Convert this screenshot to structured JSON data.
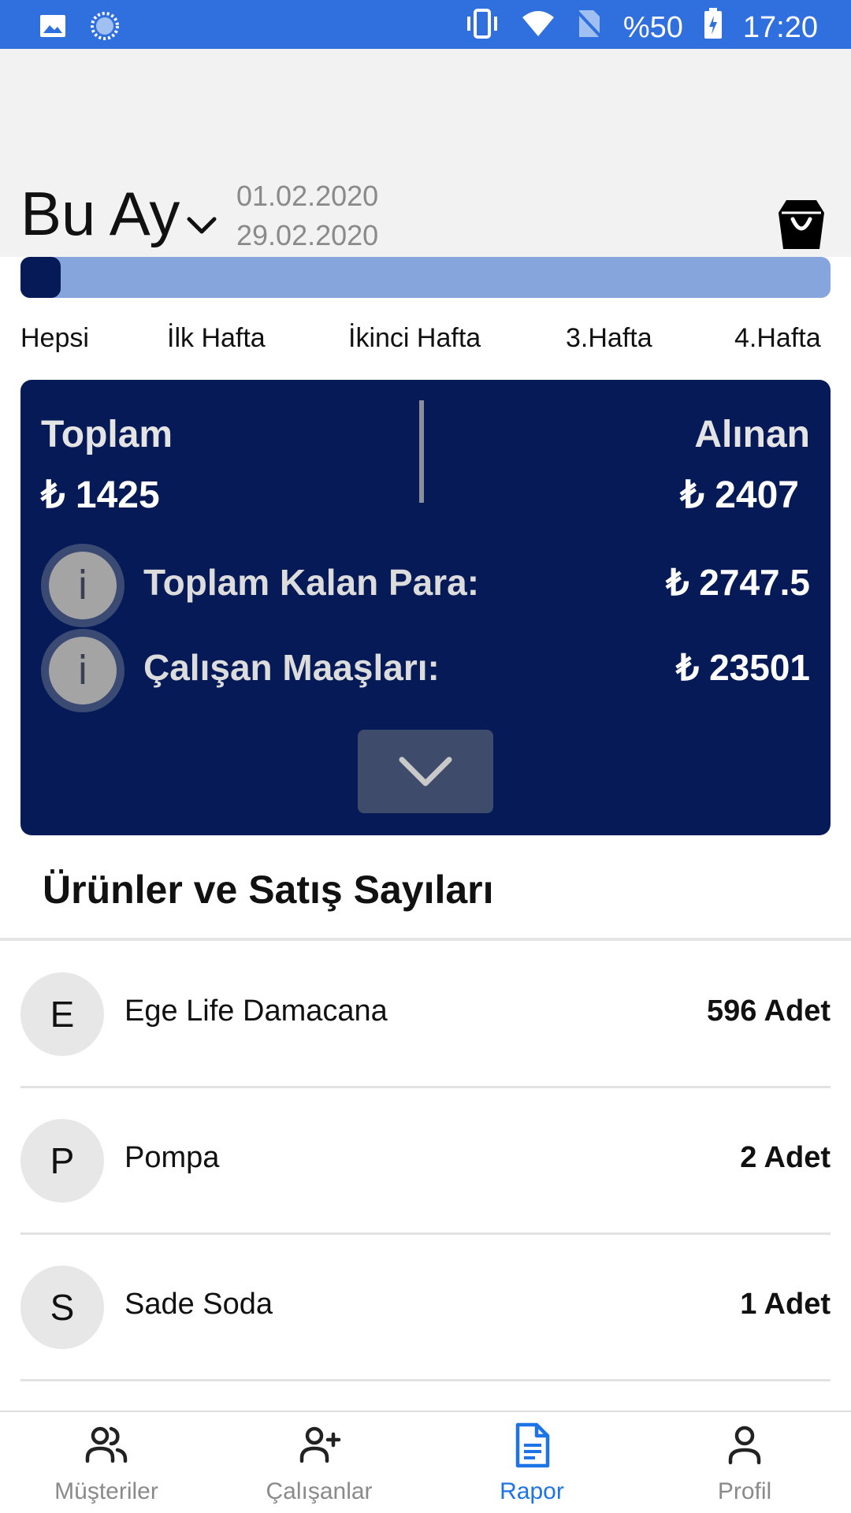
{
  "status_bar": {
    "battery": "%50",
    "time": "17:20",
    "icons": [
      "image-icon",
      "sync-icon",
      "vibrate-icon",
      "wifi-icon",
      "no-sim-icon",
      "battery-charging-icon"
    ]
  },
  "header": {
    "period": "Bu Ay",
    "date_from": "01.02.2020",
    "date_to": "29.02.2020",
    "basket_icon": "shopping-bag-icon",
    "progress_fraction": 0.05
  },
  "tabs": [
    "Hepsi",
    "İlk Hafta",
    "İkinci Hafta",
    "3.Hafta",
    "4.Hafta"
  ],
  "summary": {
    "total_label": "Toplam",
    "total_value": "₺ 1425",
    "received_label": "Alınan",
    "received_value": "₺ 2407",
    "remaining_label": "Toplam Kalan Para:",
    "remaining_value": "₺ 2747.5",
    "salaries_label": "Çalışan Maaşları:",
    "salaries_value": "₺ 23501",
    "info_glyph": "i"
  },
  "products": {
    "title": "Ürünler ve Satış Sayıları",
    "items": [
      {
        "initial": "E",
        "name": "Ege Life Damacana",
        "qty": "596 Adet"
      },
      {
        "initial": "P",
        "name": "Pompa",
        "qty": "2 Adet"
      },
      {
        "initial": "S",
        "name": "Sade Soda",
        "qty": "1 Adet"
      }
    ]
  },
  "nav": [
    {
      "label": "Müşteriler",
      "icon": "customers-icon",
      "active": false
    },
    {
      "label": "Çalışanlar",
      "icon": "add-employee-icon",
      "active": false
    },
    {
      "label": "Rapor",
      "icon": "report-icon",
      "active": true
    },
    {
      "label": "Profil",
      "icon": "profile-icon",
      "active": false
    }
  ],
  "colors": {
    "status_bar": "#2f6fde",
    "card": "#051a57",
    "progress_track": "#86a5dd",
    "active_nav": "#1d74e6"
  }
}
